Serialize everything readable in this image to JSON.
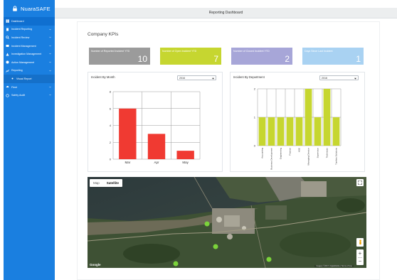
{
  "app": {
    "name": "NuaraSAFE"
  },
  "sidebar": {
    "items": [
      {
        "label": "Dashboard",
        "icon": "dashboard-icon",
        "has_chevron": false
      },
      {
        "label": "Incident Reporting",
        "icon": "incident-reporting-icon",
        "has_chevron": true
      },
      {
        "label": "Incident Review",
        "icon": "incident-review-icon",
        "has_chevron": true
      },
      {
        "label": "Incident Management",
        "icon": "incident-management-icon",
        "has_chevron": true
      },
      {
        "label": "Investigation Management",
        "icon": "investigation-icon",
        "has_chevron": true
      },
      {
        "label": "Action Management",
        "icon": "action-management-icon",
        "has_chevron": true
      },
      {
        "label": "Reporting",
        "icon": "reporting-icon",
        "has_chevron": true
      },
      {
        "label": "Visual Report",
        "icon": "visual-report-icon",
        "has_chevron": false,
        "sub": true
      },
      {
        "label": "Fleet",
        "icon": "fleet-icon",
        "has_chevron": true
      },
      {
        "label": "Safety Audit",
        "icon": "safety-audit-icon",
        "has_chevron": true
      }
    ]
  },
  "header": {
    "title": "Reporting Dashboard"
  },
  "kpi_section": {
    "title": "Company KPIs"
  },
  "kpis": [
    {
      "label": "Number of Reported Incident YTD",
      "value": "10",
      "color": "#9b9b9b"
    },
    {
      "label": "Number of Open Incident YTD",
      "value": "7",
      "color": "#c6d630"
    },
    {
      "label": "Number of Closed Incident YTD",
      "value": "2",
      "color": "#a7a6d8"
    },
    {
      "label": "Days Since Last Incident",
      "value": "1",
      "color": "#a9d2f2"
    }
  ],
  "chart_month": {
    "title": "Incident By Month",
    "select_value": "2016",
    "chart_data": {
      "type": "bar",
      "categories": [
        "Mar",
        "Apr",
        "May"
      ],
      "values": [
        6,
        3,
        1
      ],
      "ylim": [
        0,
        8
      ],
      "yticks": [
        0,
        2,
        4,
        6,
        8
      ],
      "grid": true,
      "color": "#f03a32"
    }
  },
  "chart_dept": {
    "title": "Incident By Department",
    "select_value": "2016",
    "chart_data": {
      "type": "bar",
      "categories": [
        "Accounting",
        "Business Development",
        "Engineering",
        "Finance",
        "HSE",
        "Managing Director",
        "Supervisor",
        "Technician",
        "Turnkey Solutions"
      ],
      "values": [
        1,
        1,
        1,
        1,
        1,
        2,
        1,
        2,
        1
      ],
      "ylim": [
        0,
        2
      ],
      "yticks": [
        0,
        1,
        2
      ],
      "grid": true,
      "color": "#c6d630"
    }
  },
  "map": {
    "type_options": [
      "Map",
      "Satellite"
    ],
    "selected_type": "Satellite",
    "google_label": "Google",
    "credit": "Imagery ©2017, DigitalGlobe | Terms of Use",
    "zoom_in": "+",
    "zoom_out": "−"
  }
}
